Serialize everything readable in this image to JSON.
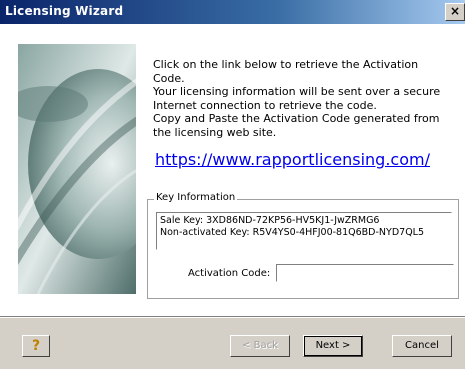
{
  "window": {
    "title": "Licensing Wizard",
    "close_label": "×"
  },
  "content": {
    "instructions": [
      "Click on the link below to retrieve the Activation Code.",
      "Your licensing information will be sent over a secure",
      "Internet connection to retrieve the code.",
      "Copy and Paste the Activation Code generated from",
      "the licensing web site."
    ],
    "link_text": "https://www.rapportlicensing.com/"
  },
  "key_info": {
    "group_label": "Key Information",
    "sale_key": "Sale Key: 3XD86ND-72KP56-HV5KJ1-JwZRMG6",
    "non_activated_key": "Non-activated Key: R5V4YS0-4HFJ00-81Q6BD-NYD7QL5",
    "activation_label": "Activation Code:",
    "activation_value": ""
  },
  "buttons": {
    "help": "?",
    "back": "< Back",
    "next": "Next >",
    "cancel": "Cancel"
  },
  "icons": {
    "help": "help-icon",
    "close": "close-icon"
  }
}
